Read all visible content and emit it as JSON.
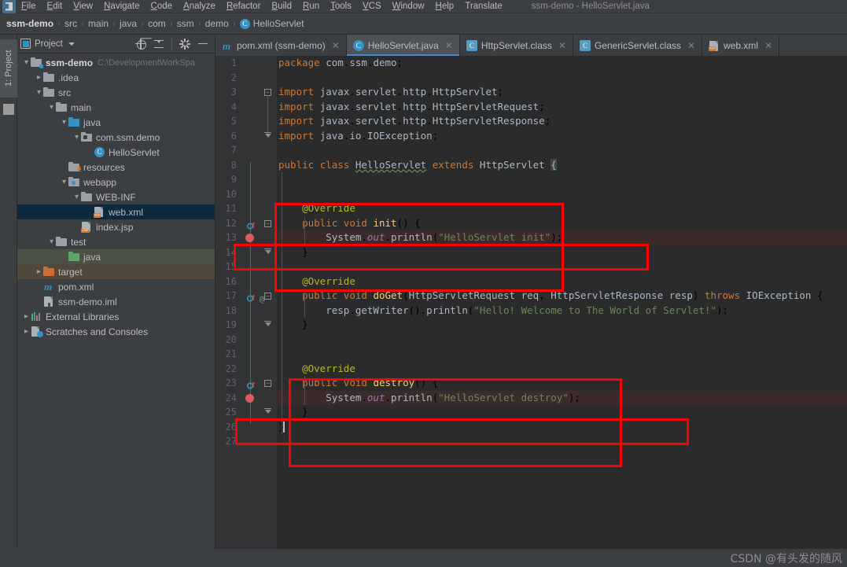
{
  "window": {
    "title": "ssm-demo - HelloServlet.java",
    "logo_icon": "intellij-idea-logo"
  },
  "menubar": {
    "items": [
      {
        "label": "File"
      },
      {
        "label": "Edit"
      },
      {
        "label": "View"
      },
      {
        "label": "Navigate"
      },
      {
        "label": "Code"
      },
      {
        "label": "Analyze"
      },
      {
        "label": "Refactor"
      },
      {
        "label": "Build"
      },
      {
        "label": "Run"
      },
      {
        "label": "Tools"
      },
      {
        "label": "VCS"
      },
      {
        "label": "Window"
      },
      {
        "label": "Help"
      },
      {
        "label": "Translate"
      }
    ]
  },
  "breadcrumb": {
    "items": [
      {
        "label": "ssm-demo",
        "bold": true
      },
      {
        "label": "src"
      },
      {
        "label": "main"
      },
      {
        "label": "java"
      },
      {
        "label": "com"
      },
      {
        "label": "ssm"
      },
      {
        "label": "demo"
      },
      {
        "label": "HelloServlet",
        "icon": "java-class-icon",
        "icon_letter": "C"
      }
    ],
    "separator": "›"
  },
  "left_strip": {
    "project_tab_label": "1: Project"
  },
  "project_panel": {
    "title": "Project",
    "tools": [
      {
        "name": "locate-icon",
        "label": "Select Opened File"
      },
      {
        "name": "collapse-all-icon",
        "label": "Collapse All"
      },
      {
        "name": "gear-icon",
        "label": "Settings"
      },
      {
        "name": "minimize-icon",
        "label": "Hide"
      }
    ],
    "tree": [
      {
        "label": "ssm-demo",
        "path": "C:\\DevelopmentWorkSpa",
        "depth": 0,
        "arrow": "down",
        "icon": "module-folder-icon",
        "bold": true
      },
      {
        "label": ".idea",
        "depth": 1,
        "arrow": "right",
        "icon": "folder-grey-icon"
      },
      {
        "label": "src",
        "depth": 1,
        "arrow": "down",
        "icon": "folder-grey-icon"
      },
      {
        "label": "main",
        "depth": 2,
        "arrow": "down",
        "icon": "folder-grey-icon"
      },
      {
        "label": "java",
        "depth": 3,
        "arrow": "down",
        "icon": "folder-source-blue-icon"
      },
      {
        "label": "com.ssm.demo",
        "depth": 4,
        "arrow": "down",
        "icon": "package-icon"
      },
      {
        "label": "HelloServlet",
        "depth": 5,
        "arrow": "none",
        "icon": "java-class-icon"
      },
      {
        "label": "resources",
        "depth": 3,
        "arrow": "none",
        "icon": "folder-resources-icon"
      },
      {
        "label": "webapp",
        "depth": 3,
        "arrow": "down",
        "icon": "folder-web-icon"
      },
      {
        "label": "WEB-INF",
        "depth": 4,
        "arrow": "down",
        "icon": "folder-grey-icon"
      },
      {
        "label": "web.xml",
        "depth": 5,
        "arrow": "none",
        "icon": "xml-file-icon",
        "selected": true
      },
      {
        "label": "index.jsp",
        "depth": 4,
        "arrow": "none",
        "icon": "jsp-file-icon"
      },
      {
        "label": "test",
        "depth": 2,
        "arrow": "down",
        "icon": "folder-grey-icon"
      },
      {
        "label": "java",
        "depth": 3,
        "arrow": "none",
        "icon": "folder-test-green-icon",
        "highlight": "green"
      },
      {
        "label": "target",
        "depth": 1,
        "arrow": "right",
        "icon": "folder-excluded-orange-icon",
        "highlight": "brown"
      },
      {
        "label": "pom.xml",
        "depth": 1,
        "arrow": "none",
        "icon": "maven-file-icon"
      },
      {
        "label": "ssm-demo.iml",
        "depth": 1,
        "arrow": "none",
        "icon": "iml-file-icon"
      },
      {
        "label": "External Libraries",
        "depth": 0,
        "arrow": "right",
        "icon": "libraries-icon"
      },
      {
        "label": "Scratches and Consoles",
        "depth": 0,
        "arrow": "right",
        "icon": "scratches-icon"
      }
    ]
  },
  "editor_tabs": [
    {
      "label": "pom.xml (ssm-demo)",
      "icon": "maven-file-icon",
      "active": false,
      "closable": true
    },
    {
      "label": "HelloServlet.java",
      "icon": "java-class-icon",
      "active": true,
      "closable": true
    },
    {
      "label": "HttpServlet.class",
      "icon": "java-compiled-class-icon",
      "active": false,
      "closable": true
    },
    {
      "label": "GenericServlet.class",
      "icon": "java-compiled-class-icon",
      "active": false,
      "closable": true
    },
    {
      "label": "web.xml",
      "icon": "xml-file-icon",
      "active": false,
      "closable": true
    }
  ],
  "editor": {
    "filename": "HelloServlet.java",
    "line_numbers": [
      1,
      2,
      3,
      4,
      5,
      6,
      7,
      8,
      9,
      10,
      11,
      12,
      13,
      14,
      15,
      16,
      17,
      18,
      19,
      20,
      21,
      22,
      23,
      24,
      25,
      26,
      27
    ],
    "lines": [
      {
        "n": 1,
        "text": "package com.ssm.demo;"
      },
      {
        "n": 2,
        "text": ""
      },
      {
        "n": 3,
        "text": "import javax.servlet.http.HttpServlet;"
      },
      {
        "n": 4,
        "text": "import javax.servlet.http.HttpServletRequest;"
      },
      {
        "n": 5,
        "text": "import javax.servlet.http.HttpServletResponse;"
      },
      {
        "n": 6,
        "text": "import java.io.IOException;"
      },
      {
        "n": 7,
        "text": ""
      },
      {
        "n": 8,
        "text": "public class HelloServlet extends HttpServlet {"
      },
      {
        "n": 9,
        "text": ""
      },
      {
        "n": 10,
        "text": ""
      },
      {
        "n": 11,
        "text": "    @Override"
      },
      {
        "n": 12,
        "text": "    public void init() {"
      },
      {
        "n": 13,
        "text": "        System.out.println(\"HelloServlet init\");",
        "highlighted": true
      },
      {
        "n": 14,
        "text": "    }"
      },
      {
        "n": 15,
        "text": ""
      },
      {
        "n": 16,
        "text": "    @Override"
      },
      {
        "n": 17,
        "text": "    public void doGet(HttpServletRequest req, HttpServletResponse resp) throws IOException {"
      },
      {
        "n": 18,
        "text": "        resp.getWriter().println(\"Hello! Welcome to The World of Servlet!\");"
      },
      {
        "n": 19,
        "text": "    }"
      },
      {
        "n": 20,
        "text": ""
      },
      {
        "n": 21,
        "text": ""
      },
      {
        "n": 22,
        "text": "    @Override"
      },
      {
        "n": 23,
        "text": "    public void destroy() {"
      },
      {
        "n": 24,
        "text": "        System.out.println(\"HelloServlet destroy\");",
        "highlighted": true
      },
      {
        "n": 25,
        "text": "    }"
      },
      {
        "n": 26,
        "text": "}"
      },
      {
        "n": 27,
        "text": ""
      }
    ],
    "gutter_markers": [
      {
        "line": 12,
        "icon": "override-method-icon"
      },
      {
        "line": 13,
        "icon": "breakpoint-icon"
      },
      {
        "line": 17,
        "icon": "override-method-icon"
      },
      {
        "line": 17,
        "icon": "annotation-at-icon"
      },
      {
        "line": 23,
        "icon": "override-method-icon"
      },
      {
        "line": 24,
        "icon": "breakpoint-icon"
      }
    ],
    "annotations": [
      {
        "name": "init-method-box",
        "around_lines": "10-15"
      },
      {
        "name": "init-println-box",
        "around_lines": "13"
      },
      {
        "name": "destroy-method-box",
        "around_lines": "21-26"
      },
      {
        "name": "destroy-println-box",
        "around_lines": "24"
      }
    ]
  },
  "watermark": {
    "text": "CSDN @有头发的随风"
  },
  "colors": {
    "accent_blue": "#3592c4",
    "annotation_red": "#fe0000",
    "editor_bg": "#2b2b2b",
    "panel_bg": "#3c3f41",
    "keyword_orange": "#cc7832",
    "string_green": "#6a8759",
    "method_yellow": "#ffc66d",
    "annotation_yellow": "#bbb529",
    "static_purple": "#9876aa",
    "selection_navy": "#0d293e"
  }
}
